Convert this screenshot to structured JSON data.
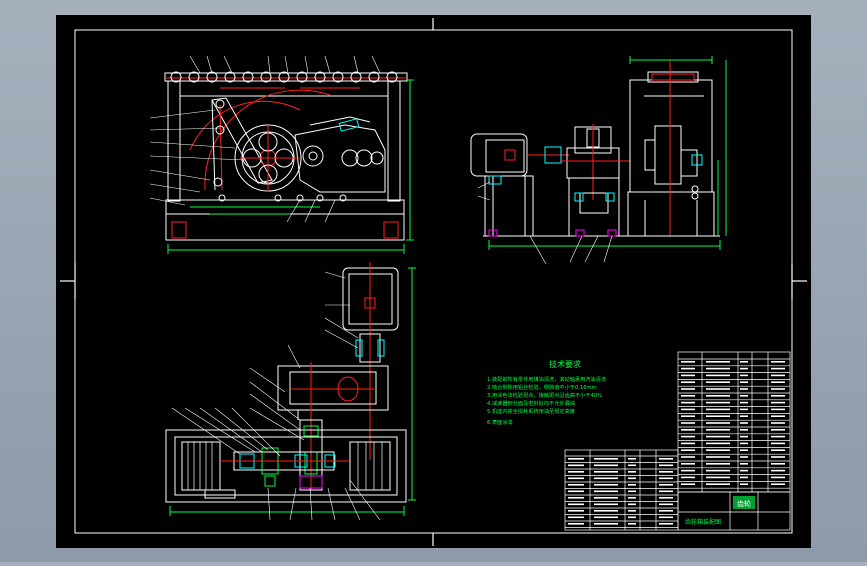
{
  "drawing": {
    "background": "#000000",
    "line_color": "#ffffff",
    "accent_red": "#ff2020",
    "accent_green": "#00ff40",
    "accent_cyan": "#00ffff",
    "accent_magenta": "#ff00ff",
    "title_block_label": "技术要求",
    "title_block_stamp": "齿轮",
    "titleblock_name": "齿轮箱装配图"
  },
  "tech_notes": [
    "1.装配前所有零件用煤油清洗，滚动轴承用汽油清洗",
    "2.啮合侧隙用铅丝检验，侧隙值不小于0.16mm",
    "3.用涂色法检验斑点，接触斑点沿齿高不小于40%",
    "4.减速器剖分面及密封处均不允许漏油",
    "5.机座内装全损耗系统用油至规定高度",
    "6.表面涂漆"
  ]
}
